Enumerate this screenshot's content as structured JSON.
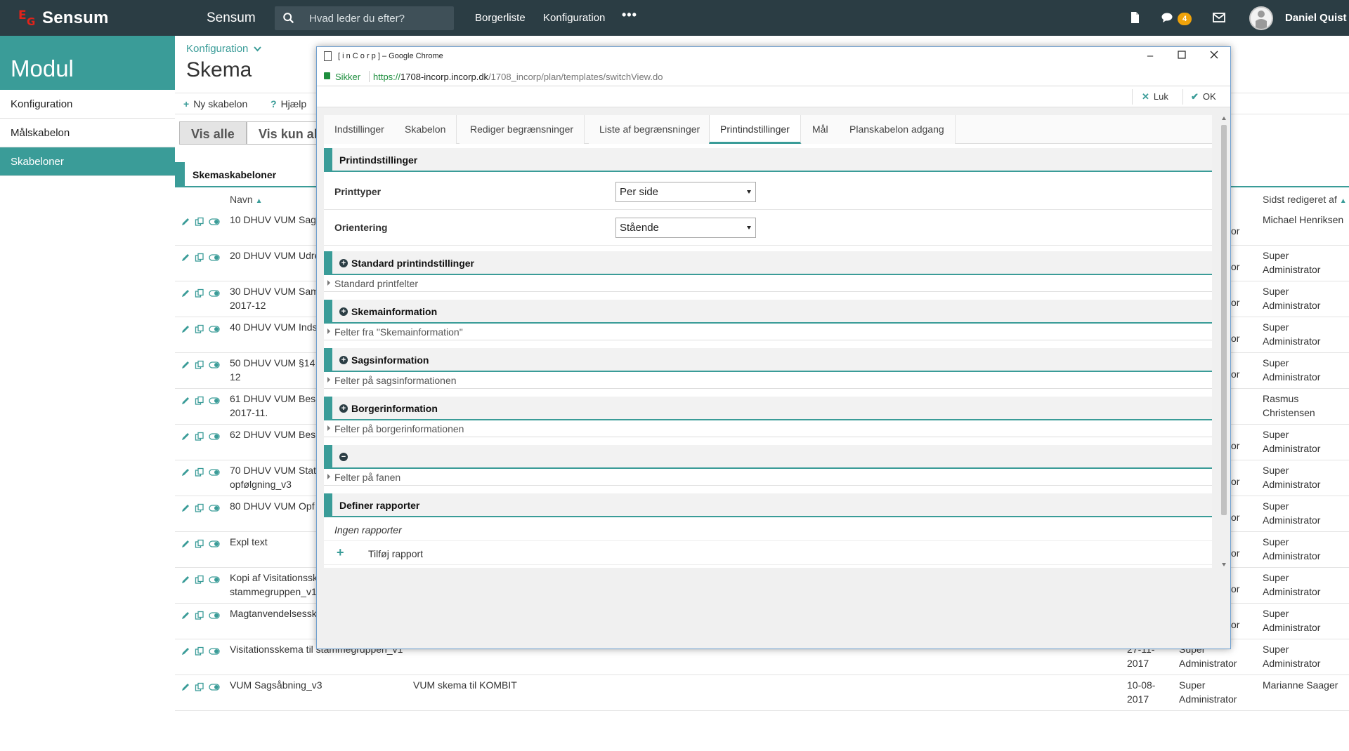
{
  "topbar": {
    "logo_letters": [
      "E",
      "G"
    ],
    "logo_text": "Sensum",
    "app_title": "Sensum",
    "search_placeholder": "Hvad leder du efter?",
    "nav": [
      "Borgerliste",
      "Konfiguration"
    ],
    "more": "•••",
    "messages_badge": "4",
    "user_name": "Daniel Quist",
    "icons": [
      "search-icon",
      "document-icon",
      "chat-icon",
      "mail-icon",
      "avatar"
    ],
    "accent": "#3a9c98",
    "bar_color": "#2b3d44",
    "badge_color": "#f0a30a"
  },
  "sidebar": {
    "title": "Modul",
    "items": [
      {
        "label": "Konfiguration",
        "active": false
      },
      {
        "label": "Målskabelon",
        "active": false
      },
      {
        "label": "Skabeloner",
        "active": true
      }
    ]
  },
  "main": {
    "breadcrumb": "Konfiguration",
    "title": "Skema",
    "toolbar": {
      "new_label": "Ny skabelon",
      "help_label": "Hjælp"
    },
    "filters": {
      "all": "Vis alle",
      "only": "Vis kun ak"
    },
    "section_title": "Skemaskabeloner",
    "columns": {
      "name": "Navn",
      "last_edited_by": "Sidst redigeret af"
    },
    "rows": [
      {
        "name": "10 DHUV VUM Sag",
        "name2": "",
        "desc": "",
        "date": "",
        "date2": "",
        "creator": "",
        "creator2": "",
        "edited": "Michael Henriksen",
        "edited2": "",
        "hidden_frag": "or"
      },
      {
        "name": "20 DHUV VUM Udre",
        "name2": "",
        "desc": "",
        "date": "",
        "date2": "",
        "creator": "",
        "creator2": "",
        "edited": "Super",
        "edited2": "Administrator",
        "hidden_frag": "or"
      },
      {
        "name": "30 DHUV VUM Sam",
        "name2": "2017-12",
        "desc": "",
        "date": "",
        "date2": "",
        "creator": "",
        "creator2": "",
        "edited": "Super",
        "edited2": "Administrator",
        "hidden_frag": "or"
      },
      {
        "name": "40 DHUV VUM Inds",
        "name2": "",
        "desc": "",
        "date": "",
        "date2": "",
        "creator": "",
        "creator2": "",
        "edited": "Super",
        "edited2": "Administrator",
        "hidden_frag": "or"
      },
      {
        "name": "50 DHUV VUM §14",
        "name2": "12",
        "desc": "",
        "date": "",
        "date2": "",
        "creator": "",
        "creator2": "",
        "edited": "Super",
        "edited2": "Administrator",
        "hidden_frag": "or"
      },
      {
        "name": "61 DHUV VUM Bes",
        "name2": "2017-11.",
        "desc": "",
        "date": "",
        "date2": "",
        "creator": "",
        "creator2": "",
        "edited": "Rasmus",
        "edited2": "Christensen",
        "hidden_frag": ""
      },
      {
        "name": "62 DHUV VUM Bes",
        "name2": "",
        "desc": "",
        "date": "",
        "date2": "",
        "creator": "",
        "creator2": "",
        "edited": "Super",
        "edited2": "Administrator",
        "hidden_frag": "or"
      },
      {
        "name": "70 DHUV VUM Stat",
        "name2": "opfølgning_v3",
        "desc": "",
        "date": "",
        "date2": "",
        "creator": "",
        "creator2": "",
        "edited": "Super",
        "edited2": "Administrator",
        "hidden_frag": "or"
      },
      {
        "name": "80 DHUV VUM Opf",
        "name2": "",
        "desc": "",
        "date": "",
        "date2": "",
        "creator": "",
        "creator2": "",
        "edited": "Super",
        "edited2": "Administrator",
        "hidden_frag": "or"
      },
      {
        "name": "Expl text",
        "name2": "",
        "desc": "",
        "date": "",
        "date2": "",
        "creator": "",
        "creator2": "",
        "edited": "Super",
        "edited2": "Administrator",
        "hidden_frag": "or"
      },
      {
        "name": "Kopi af Visitationssk",
        "name2": "stammegruppen_v1",
        "desc": "",
        "date": "",
        "date2": "",
        "creator": "",
        "creator2": "",
        "edited": "Super",
        "edited2": "Administrator",
        "hidden_frag": "or"
      },
      {
        "name": "Magtanvendelsessk",
        "name2": "",
        "desc": "",
        "date": "",
        "date2": "",
        "creator": "",
        "creator2": "",
        "edited": "Super",
        "edited2": "Administrator",
        "hidden_frag": "or"
      },
      {
        "name": "Visitationsskema til stammegruppen_v1",
        "name2": "",
        "desc": "",
        "date": "27-11-",
        "date2": "2017",
        "creator": "Super",
        "creator2": "Administrator",
        "edited": "Super",
        "edited2": "Administrator",
        "hidden_frag": ""
      },
      {
        "name": "VUM Sagsåbning_v3",
        "name2": "",
        "desc": "VUM skema til KOMBIT",
        "date": "10-08-",
        "date2": "2017",
        "creator": "Super",
        "creator2": "Administrator",
        "edited": "Marianne Saager",
        "edited2": "",
        "hidden_frag": ""
      }
    ]
  },
  "popup": {
    "window_title": "[ i n C o r p ] – Google Chrome",
    "secure_label": "Sikker",
    "url_scheme": "https://",
    "url_host": "1708-incorp.incorp.dk",
    "url_path": "/1708_incorp/plan/templates/switchView.do",
    "close_label": "Luk",
    "ok_label": "OK",
    "tabs": [
      "Indstillinger",
      "Skabelon",
      "Rediger begrænsninger",
      "Liste af begrænsninger",
      "Printindstillinger",
      "Mål",
      "Planskabelon adgang"
    ],
    "active_tab": "Printindstillinger",
    "print_section": "Printindstillinger",
    "print_type_label": "Printtyper",
    "print_type_value": "Per side",
    "orientation_label": "Orientering",
    "orientation_value": "Stående",
    "groups": [
      {
        "title": "Standard printindstillinger",
        "sub": "Standard printfelter"
      },
      {
        "title": "Skemainformation",
        "sub": "Felter fra \"Skemainformation\""
      },
      {
        "title": "Sagsinformation",
        "sub": "Felter på sagsinformationen"
      },
      {
        "title": "Borgerinformation",
        "sub": "Felter på borgerinformationen"
      },
      {
        "title": "",
        "sub": "Felter på fanen"
      }
    ],
    "reports_title": "Definer rapporter",
    "no_reports": "Ingen rapporter",
    "add_report": "Tilføj rapport",
    "add_symbol": "+"
  }
}
